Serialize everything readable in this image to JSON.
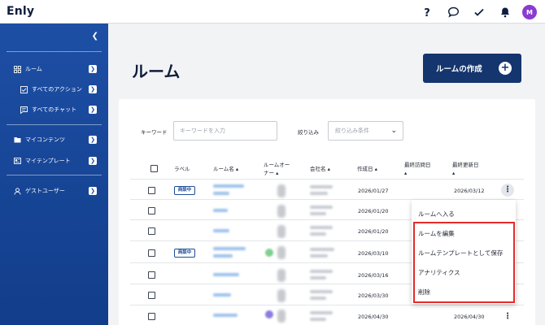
{
  "header": {
    "logo": "Enly",
    "avatar_initial": "M",
    "icons": [
      "help-icon",
      "chat-icon",
      "check-icon",
      "bell-icon"
    ]
  },
  "sidebar": {
    "items": [
      {
        "label": "ルーム",
        "icon": "grid-icon"
      },
      {
        "label": "すべてのアクション",
        "icon": "checkbox-icon"
      },
      {
        "label": "すべてのチャット",
        "icon": "chat-icon"
      },
      {
        "label": "マイコンテンツ",
        "icon": "folder-icon"
      },
      {
        "label": "マイテンプレート",
        "icon": "template-icon"
      },
      {
        "label": "ゲストユーザー",
        "icon": "user-icon"
      }
    ]
  },
  "main": {
    "title": "ルーム",
    "create_button": "ルームの作成",
    "filters": {
      "keyword_label": "キーワード",
      "keyword_placeholder": "キーワードを入力",
      "filter_label": "絞り込み",
      "filter_placeholder": "絞り込み条件"
    },
    "table": {
      "headers": {
        "label": "ラベル",
        "room_name": "ルーム名",
        "room_owner_1": "ルームオー",
        "room_owner_2": "ナー",
        "company": "会社名",
        "created": "作成日",
        "last_visit_1": "最終訪問日",
        "last_update": "最終更新日"
      },
      "rows": [
        {
          "badge": "商談中",
          "created": "2026/01/27",
          "updated": "2026/03/12"
        },
        {
          "badge": "",
          "created": "2026/01/20",
          "updated": ""
        },
        {
          "badge": "",
          "created": "2026/01/20",
          "updated": ""
        },
        {
          "badge": "商談中",
          "created": "2026/03/10",
          "updated": ""
        },
        {
          "badge": "",
          "created": "2026/03/16",
          "updated": ""
        },
        {
          "badge": "",
          "created": "2026/03/30",
          "updated": ""
        },
        {
          "badge": "",
          "created": "2026/04/30",
          "updated": "2026/04/30"
        }
      ]
    },
    "context_menu": {
      "items": [
        "ルームへ入る",
        "ルームを編集",
        "ルームテンプレートとして保存",
        "アナリティクス",
        "削除"
      ]
    }
  },
  "colors": {
    "sidebar": "#1d4fa5",
    "primary_button": "#14356e",
    "highlight": "#e32b2b",
    "avatar": "#8a3bd1"
  }
}
